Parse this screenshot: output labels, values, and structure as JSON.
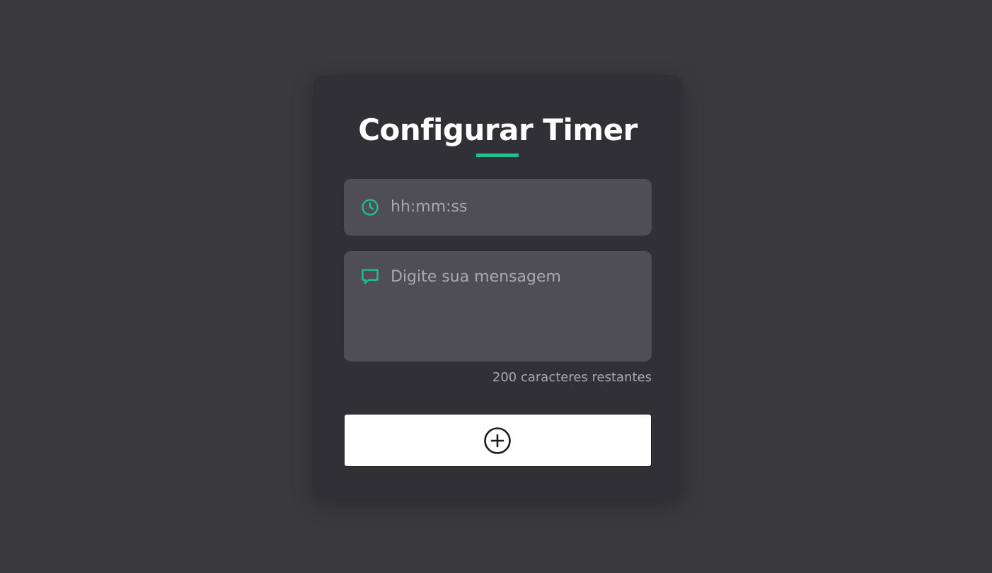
{
  "card": {
    "title": "Configurar Timer"
  },
  "time_field": {
    "placeholder": "hh:mm:ss",
    "value": "",
    "icon": "clock-icon"
  },
  "message_field": {
    "placeholder": "Digite sua mensagem",
    "value": "",
    "icon": "chat-bubble-icon"
  },
  "counter": {
    "text": "200 caracteres restantes"
  },
  "add_button": {
    "icon": "plus-circle-icon"
  },
  "colors": {
    "background": "#3a3a3c",
    "card": "#313034",
    "field": "#4f4e53",
    "accent": "#1fc190",
    "button": "#ffffff"
  }
}
